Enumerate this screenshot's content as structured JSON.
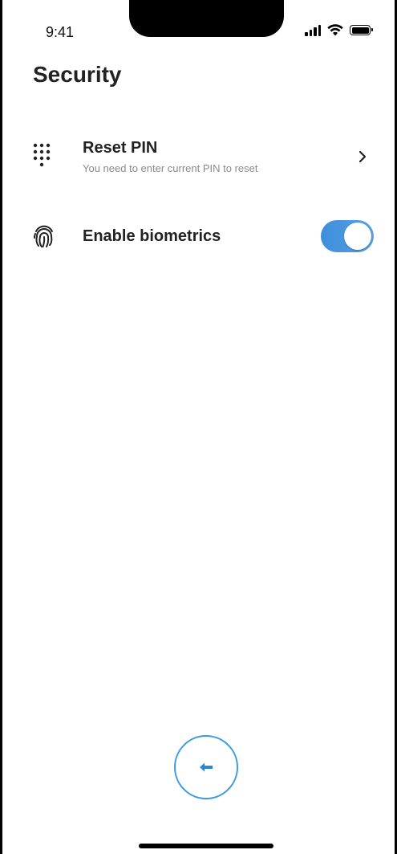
{
  "status_bar": {
    "time": "9:41"
  },
  "page": {
    "title": "Security"
  },
  "settings": {
    "items": [
      {
        "icon": "keypad-icon",
        "title": "Reset PIN",
        "subtitle": "You need to enter current PIN to reset",
        "control": "chevron-right-icon"
      },
      {
        "icon": "fingerprint-icon",
        "title": "Enable biometrics",
        "control": "toggle",
        "enabled": true
      }
    ]
  },
  "navigation": {
    "back_icon": "arrow-left-icon"
  },
  "colors": {
    "accent": "#3d9be0",
    "toggle_on": "#4a95de",
    "text_primary": "#222222",
    "text_secondary": "#8a8a8a"
  }
}
